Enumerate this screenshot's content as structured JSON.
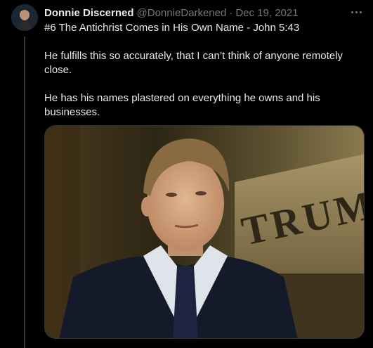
{
  "tweet": {
    "author_name": "Donnie Discerned",
    "handle": "@DonnieDarkened",
    "separator": "·",
    "date": "Dec 19, 2021",
    "text_lines": [
      "#6 The Antichrist Comes in His Own Name - John 5:43",
      "He fulfills this so accurately, that I can’t think of anyone remotely close.",
      "He has his names plastered on everything he owns and his businesses."
    ]
  },
  "icons": {
    "more": "more-horizontal-icon"
  },
  "media": {
    "sign_text": "TRUMP"
  },
  "colors": {
    "background": "#000000",
    "text": "#e7e9ea",
    "secondary": "#71767b"
  }
}
